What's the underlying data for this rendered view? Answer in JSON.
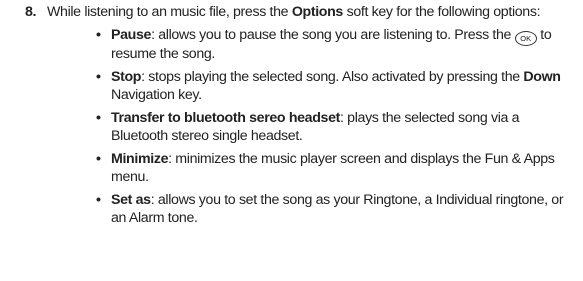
{
  "step": {
    "number": "8.",
    "text_before": "While listening to an music file, press the ",
    "options_key": "Options",
    "text_after": " soft key for the following options:"
  },
  "options": [
    {
      "term": "Pause",
      "desc_before": ": allows you to pause the song you are listening to. Press the ",
      "key_icon": "ok-key-icon",
      "key_label": "OK",
      "desc_after": " to resume the song."
    },
    {
      "term": "Stop",
      "desc_before": ": stops playing the selected song. Also activated by pressing the ",
      "key_term": "Down",
      "desc_after": " Navigation key."
    },
    {
      "term": "Transfer to bluetooth sereo headset",
      "desc": ": plays the selected song via a Bluetooth stereo single headset."
    },
    {
      "term": "Minimize",
      "desc": ": minimizes the music player screen and displays the Fun & Apps menu."
    },
    {
      "term": "Set as",
      "desc": ": allows you to set the song as your Ringtone, a Individual ringtone, or an Alarm tone."
    }
  ],
  "bullet_glyph": "•"
}
